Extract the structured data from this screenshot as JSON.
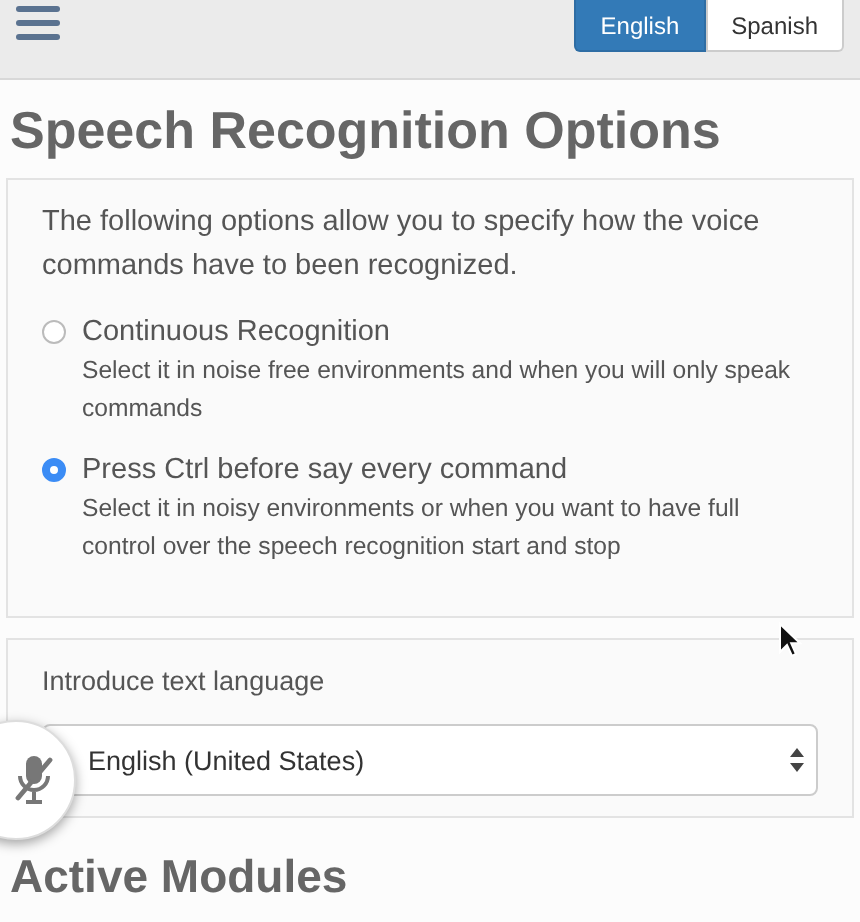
{
  "languages": [
    {
      "label": "English",
      "selected": true
    },
    {
      "label": "Spanish",
      "selected": false
    }
  ],
  "title": "Speech Recognition Options",
  "recognition": {
    "intro": "The following options allow you to specify how the voice commands have to been recognized.",
    "options": [
      {
        "label": "Continuous Recognition",
        "description": "Select it in noise free environments and when you will only speak commands",
        "selected": false
      },
      {
        "label": "Press Ctrl before say every command",
        "description": "Select it in noisy environments or when you want to have full control over the speech recognition start and stop",
        "selected": true
      }
    ]
  },
  "text_language": {
    "label": "Introduce text language",
    "value": "English (United States)"
  },
  "mic_button": {
    "muted": true
  },
  "section_2_title": "Active Modules"
}
